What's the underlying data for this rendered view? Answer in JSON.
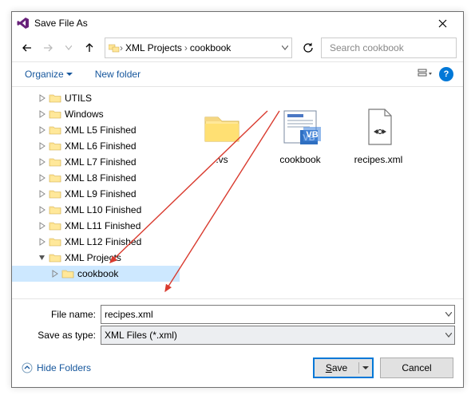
{
  "title": "Save File As",
  "breadcrumbs": [
    "XML Projects",
    "cookbook"
  ],
  "search": {
    "placeholder": "Search cookbook"
  },
  "toolbar": {
    "organize": "Organize",
    "newfolder": "New folder"
  },
  "tree": [
    {
      "indent": 2,
      "expand": ">",
      "label": "UTILS",
      "sel": false
    },
    {
      "indent": 2,
      "expand": ">",
      "label": "Windows",
      "sel": false
    },
    {
      "indent": 2,
      "expand": ">",
      "label": "XML L5 Finished",
      "sel": false
    },
    {
      "indent": 2,
      "expand": ">",
      "label": "XML L6 Finished",
      "sel": false
    },
    {
      "indent": 2,
      "expand": ">",
      "label": "XML L7 Finished",
      "sel": false
    },
    {
      "indent": 2,
      "expand": ">",
      "label": "XML L8 Finished",
      "sel": false
    },
    {
      "indent": 2,
      "expand": ">",
      "label": "XML L9 Finished",
      "sel": false
    },
    {
      "indent": 2,
      "expand": ">",
      "label": "XML L10 Finished",
      "sel": false
    },
    {
      "indent": 2,
      "expand": ">",
      "label": "XML L11 Finished",
      "sel": false
    },
    {
      "indent": 2,
      "expand": ">",
      "label": "XML L12 Finished",
      "sel": false
    },
    {
      "indent": 2,
      "expand": "v",
      "label": "XML Projects",
      "sel": false
    },
    {
      "indent": 3,
      "expand": ">",
      "label": "cookbook",
      "sel": true
    }
  ],
  "content_items": [
    {
      "label": ".vs",
      "kind": "folder"
    },
    {
      "label": "cookbook",
      "kind": "vbproj"
    },
    {
      "label": "recipes.xml",
      "kind": "xmlfile"
    }
  ],
  "filename_label": "File name:",
  "filename_value": "recipes.xml",
  "savetype_label": "Save as type:",
  "savetype_value": "XML Files (*.xml)",
  "hide_folders": "Hide Folders",
  "save_label": "Save",
  "cancel_label": "Cancel"
}
